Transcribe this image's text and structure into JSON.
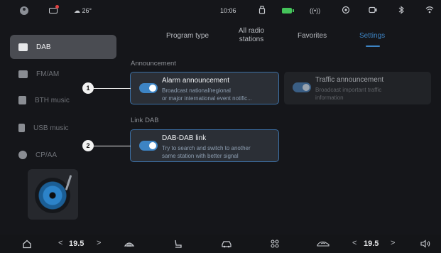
{
  "status_bar": {
    "weather": "☁ 26°",
    "time": "10:06",
    "signal": "((•))"
  },
  "sidebar": {
    "items": [
      {
        "label": "DAB",
        "active": true
      },
      {
        "label": "FM/AM",
        "active": false
      },
      {
        "label": "BTH music",
        "active": false
      },
      {
        "label": "USB music",
        "active": false
      },
      {
        "label": "CP/AA",
        "active": false
      }
    ]
  },
  "tabs": [
    {
      "label": "Program type"
    },
    {
      "label": "All radio stations"
    },
    {
      "label": "Favorites"
    },
    {
      "label": "Settings",
      "active": true
    }
  ],
  "announcement": {
    "title": "Announcement",
    "alarm": {
      "title": "Alarm announcement",
      "desc_line1": "Broadcast national/regional",
      "desc_line2": "or major international event notific...",
      "enabled": true
    },
    "traffic": {
      "title": "Traffic announcement",
      "desc_line1": "Broadcast important traffic",
      "desc_line2": "information",
      "enabled": true
    }
  },
  "link_dab": {
    "title": "Link DAB",
    "dab_link": {
      "title": "DAB-DAB link",
      "desc_line1": "Try to search and switch to another",
      "desc_line2": "same station with better signal",
      "enabled": true
    }
  },
  "callouts": [
    "1",
    "2"
  ],
  "bottom_bar": {
    "left_temp": "19.5",
    "right_temp": "19.5",
    "chev_left": "<",
    "chev_right": ">"
  },
  "colors": {
    "accent": "#3d84c4",
    "background": "#15161a",
    "sidebar_active": "#4a4c52"
  }
}
